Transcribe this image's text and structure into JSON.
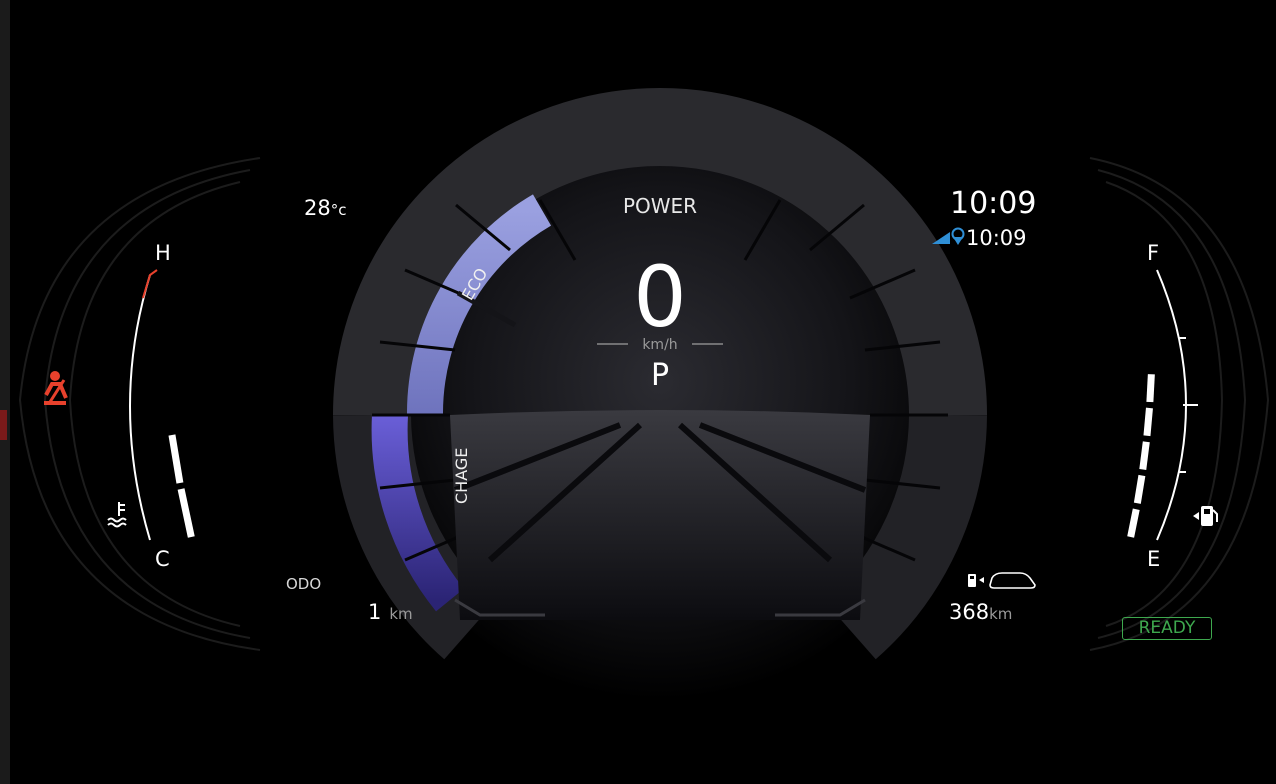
{
  "left_panel": {
    "outside_temperature": "28",
    "temperature_unit": "°c",
    "coolant_hot_label": "H",
    "coolant_cold_label": "C",
    "coolant_level_fraction": 0.45,
    "odometer_label": "ODO",
    "odometer_value": "1",
    "odometer_unit": "km",
    "icons": [
      "seatbelt-warning-icon",
      "coolant-temperature-icon"
    ]
  },
  "center": {
    "power_label": "POWER",
    "eco_label": "ECO",
    "charge_label": "CHAGE",
    "speed_value": "0",
    "speed_unit": "km/h",
    "gear": "P"
  },
  "right_panel": {
    "clock": "10:09",
    "navigation_arrival_time": "10:09",
    "fuel_full_label": "F",
    "fuel_empty_label": "E",
    "fuel_level_fraction": 0.6,
    "range_value": "368",
    "range_unit": "km",
    "status_badge": "READY",
    "icons": [
      "navigation-pin-icon",
      "fuel-pump-icon",
      "range-car-icon"
    ]
  },
  "colors": {
    "background": "#000000",
    "eco_zone": "#8e93d6",
    "charge_zone": "#5a4fc8",
    "warning_red": "#e8412c",
    "ready_green": "#3ea84e",
    "nav_blue": "#2f8fd6",
    "text": "#ffffff"
  }
}
